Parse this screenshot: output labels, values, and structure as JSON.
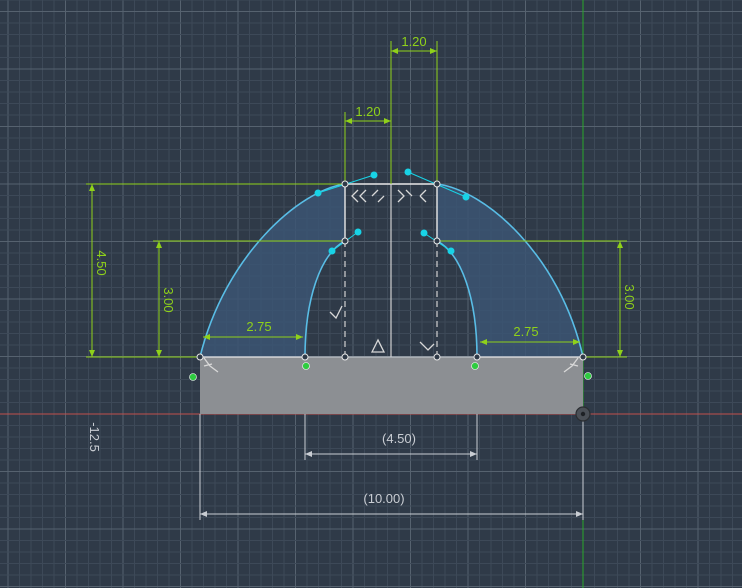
{
  "sketch": {
    "dimensions": {
      "top_width": "1.20",
      "inner_width": "1.20",
      "outer_height": "4.50",
      "inner_height": "3.00",
      "right_height": "3.00",
      "left_offset": "2.75",
      "right_offset": "2.75",
      "reference_width": "(4.50)",
      "reference_total": "(10.00)",
      "coordinate": "-12.5"
    },
    "colors": {
      "background": "#2f3a48",
      "grid_minor": "#3d4958",
      "grid_major": "#56626f",
      "dimension": "#8fd11a",
      "curve": "#59bde6",
      "handle": "#18d3e6",
      "green_point": "#2ecc40",
      "body_fill": "#8c8f93",
      "x_axis": "#c0504d",
      "y_axis": "#29a82a",
      "constraint_line": "#e8e8e8"
    }
  }
}
